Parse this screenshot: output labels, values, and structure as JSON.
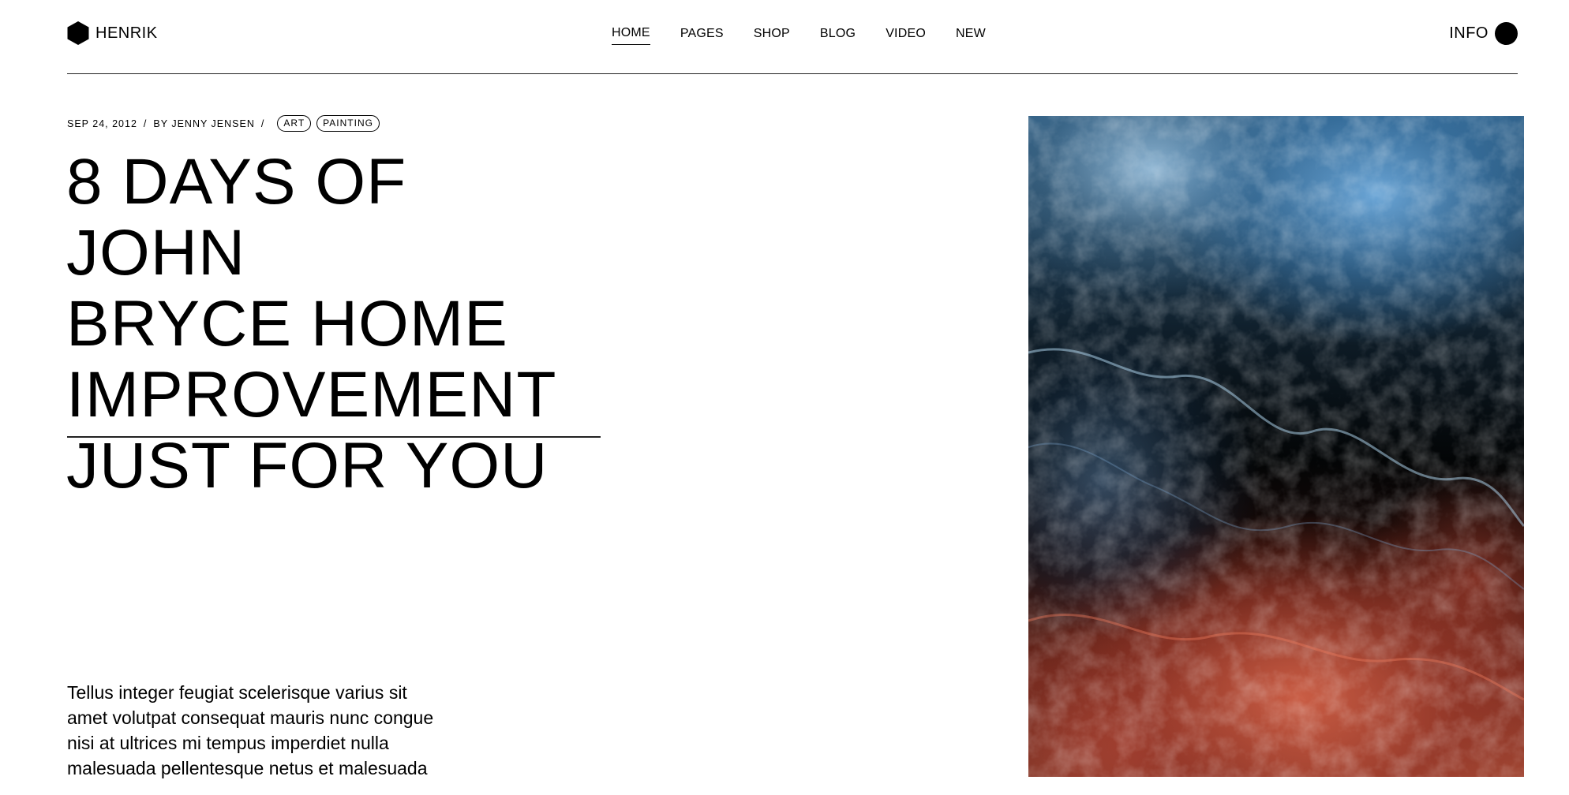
{
  "brand": {
    "name": "HENRIK",
    "logo_icon": "hexagon-icon"
  },
  "nav": {
    "items": [
      {
        "label": "HOME",
        "active": true
      },
      {
        "label": "PAGES",
        "active": false
      },
      {
        "label": "SHOP",
        "active": false
      },
      {
        "label": "BLOG",
        "active": false
      },
      {
        "label": "VIDEO",
        "active": false
      },
      {
        "label": "NEW",
        "active": false
      }
    ]
  },
  "header_right": {
    "label": "INFO",
    "icon": "circle-icon"
  },
  "post": {
    "date": "SEP 24, 2012",
    "author": "BY JENNY JENSEN",
    "separator": "/",
    "tags": [
      "ART",
      "PAINTING"
    ],
    "title_lines": [
      "8 DAYS OF JOHN",
      "BRYCE HOME",
      "IMPROVEMENT",
      "JUST FOR YOU"
    ],
    "excerpt_lines": [
      "Tellus integer feugiat scelerisque varius sit",
      "amet volutpat consequat mauris nunc congue",
      "nisi at ultrices mi tempus imperdiet nulla",
      "malesuada pellentesque netus et malesuada"
    ]
  },
  "colors": {
    "text": "#000000",
    "background": "#ffffff",
    "artwork_blue": "#3b7aa8",
    "artwork_red": "#b54a34"
  }
}
